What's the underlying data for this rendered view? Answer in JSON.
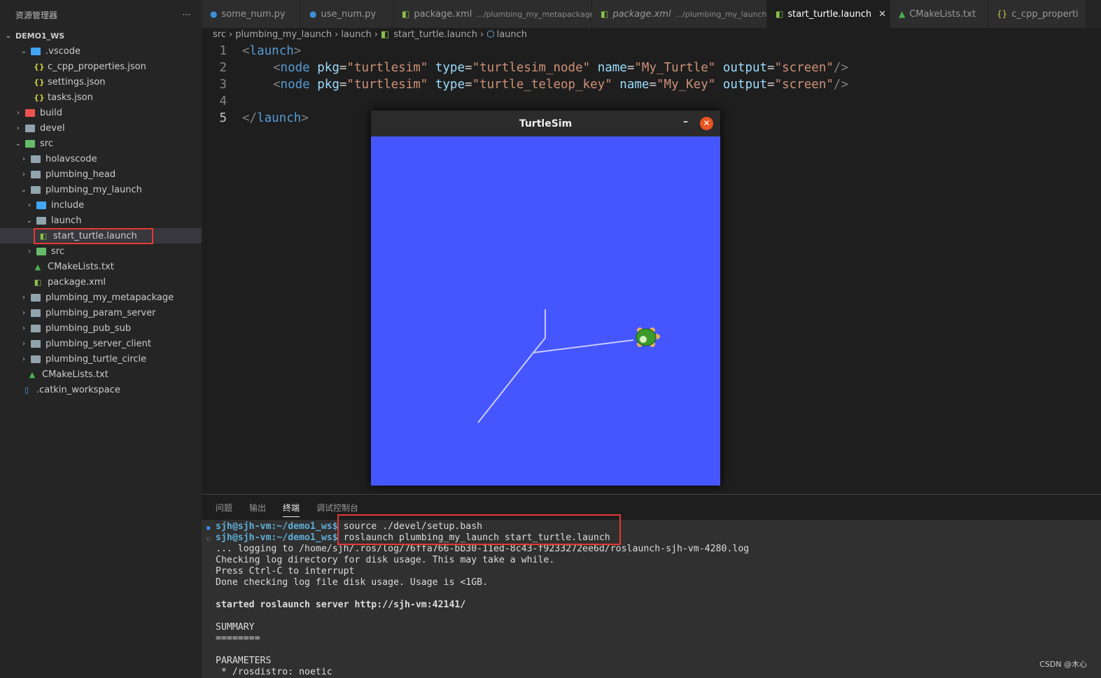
{
  "sidebar": {
    "title": "资源管理器",
    "more": "···",
    "root": "DEMO1_WS",
    "items": [
      ".vscode",
      "c_cpp_properties.json",
      "settings.json",
      "tasks.json",
      "build",
      "devel",
      "src",
      "holavscode",
      "plumbing_head",
      "plumbing_my_launch",
      "include",
      "launch",
      "start_turtle.launch",
      "src",
      "CMakeLists.txt",
      "package.xml",
      "plumbing_my_metapackage",
      "plumbing_param_server",
      "plumbing_pub_sub",
      "plumbing_server_client",
      "plumbing_turtle_circle",
      "CMakeLists.txt",
      ".catkin_workspace"
    ]
  },
  "tabs": [
    {
      "label": "some_num.py",
      "desc": ""
    },
    {
      "label": "use_num.py",
      "desc": ""
    },
    {
      "label": "package.xml",
      "desc": ".../plumbing_my_metapackage"
    },
    {
      "label": "package.xml",
      "desc": ".../plumbing_my_launch"
    },
    {
      "label": "start_turtle.launch",
      "desc": ""
    },
    {
      "label": "CMakeLists.txt",
      "desc": ""
    },
    {
      "label": "c_cpp_properti",
      "desc": ""
    }
  ],
  "breadcrumb": [
    "src",
    "plumbing_my_launch",
    "launch",
    "start_turtle.launch",
    "launch"
  ],
  "code": {
    "numbers": [
      "1",
      "2",
      "3",
      "4",
      "5"
    ],
    "open": "launch",
    "node": "node",
    "pkg": "pkg",
    "type": "type",
    "name": "name",
    "output": "output",
    "n1": {
      "pkg": "\"turtlesim\"",
      "type": "\"turtlesim_node\"",
      "name": "\"My_Turtle\"",
      "output": "\"screen\""
    },
    "n2": {
      "pkg": "\"turtlesim\"",
      "type": "\"turtle_teleop_key\"",
      "name": "\"My_Key\"",
      "output": "\"screen\""
    }
  },
  "turtlesim": {
    "title": "TurtleSim",
    "minimize": "–",
    "close": "✕",
    "bg": "#4556ff"
  },
  "panel": {
    "tabs": [
      "问题",
      "输出",
      "终端",
      "调试控制台"
    ]
  },
  "terminal": {
    "prompt": "sjh@sjh-vm:~/demo1_ws$",
    "cmd1": " source ./devel/setup.bash",
    "cmd2": " roslaunch plumbing_my_launch start_turtle.launch",
    "lines": [
      "... logging to /home/sjh/.ros/log/76ffa766-bb30-11ed-8c43-f9233272ee6d/roslaunch-sjh-vm-4280.log",
      "Checking log directory for disk usage. This may take a while.",
      "Press Ctrl-C to interrupt",
      "Done checking log file disk usage. Usage is <1GB.",
      "",
      "started roslaunch server http://sjh-vm:42141/",
      "",
      "SUMMARY",
      "========",
      "",
      "PARAMETERS",
      " * /rosdistro: noetic"
    ]
  },
  "watermark": "CSDN @木心"
}
